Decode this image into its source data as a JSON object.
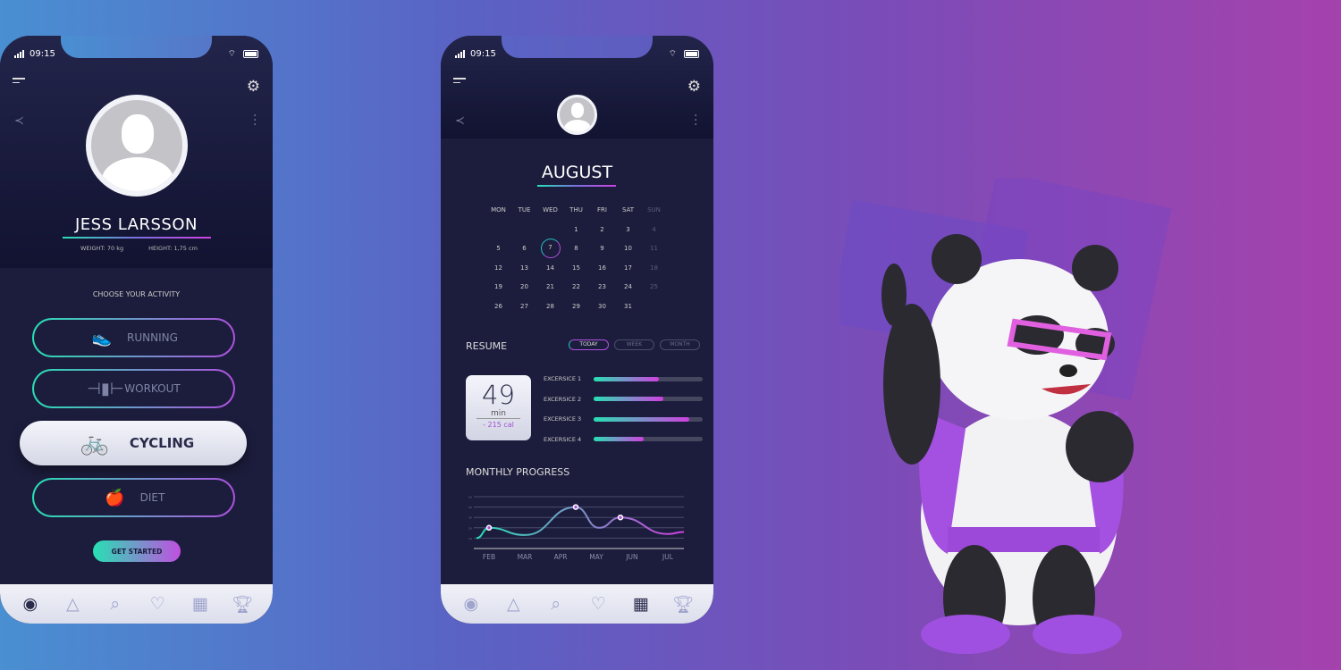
{
  "status": {
    "time": "09:15"
  },
  "profile": {
    "name": "JESS LARSSON",
    "weight": "WEIGHT: 70 kg",
    "height": "HEIGHT: 1,75 cm",
    "choose": "CHOOSE YOUR ACTIVITY",
    "activities": [
      {
        "label": "RUNNING",
        "icon": "shoe-icon",
        "selected": false
      },
      {
        "label": "WORKOUT",
        "icon": "dumbbell-icon",
        "selected": false
      },
      {
        "label": "CYCLING",
        "icon": "bicycle-icon",
        "selected": true
      },
      {
        "label": "DIET",
        "icon": "apple-icon",
        "selected": false
      }
    ],
    "cta": "GET STARTED"
  },
  "nav": [
    {
      "icon": "profile-icon"
    },
    {
      "icon": "navigation-icon"
    },
    {
      "icon": "search-icon"
    },
    {
      "icon": "heart-rate-icon"
    },
    {
      "icon": "calendar-icon"
    },
    {
      "icon": "trophy-icon"
    }
  ],
  "calendar": {
    "month": "AUGUST",
    "days": [
      "MON",
      "TUE",
      "WED",
      "THU",
      "FRI",
      "SAT",
      "SUN"
    ],
    "first_weekday": 4,
    "length": 31,
    "today": 7
  },
  "resume": {
    "title": "RESUME",
    "tabs": [
      "TODAY",
      "WEEK",
      "MONTH"
    ],
    "active_tab": "TODAY",
    "minutes": "49",
    "unit": "min",
    "calories": "- 215 cal",
    "exercises": [
      {
        "label": "EXCERSICE 1",
        "progress": 0.6
      },
      {
        "label": "EXCERSICE 2",
        "progress": 0.64
      },
      {
        "label": "EXCERSICE 3",
        "progress": 0.88
      },
      {
        "label": "EXCERSICE 4",
        "progress": 0.46
      }
    ]
  },
  "chart_data": {
    "type": "line",
    "title": "MONTHLY PROGRESS",
    "categories": [
      "FEB",
      "MAR",
      "APR",
      "MAY",
      "JUN",
      "JUL"
    ],
    "yticks": [
      10,
      20,
      30,
      40,
      50
    ],
    "ylim": [
      0,
      50
    ],
    "grid": true,
    "values": [
      20,
      13,
      40,
      20,
      30,
      14
    ],
    "markers": [
      "FEB",
      "APR",
      "JUN"
    ],
    "colors": [
      "#27e0b3",
      "#d040e0"
    ]
  },
  "colors": {
    "accent_start": "#27e0b3",
    "accent_end": "#d040e0",
    "phone_bg": "#1c1d3c"
  }
}
